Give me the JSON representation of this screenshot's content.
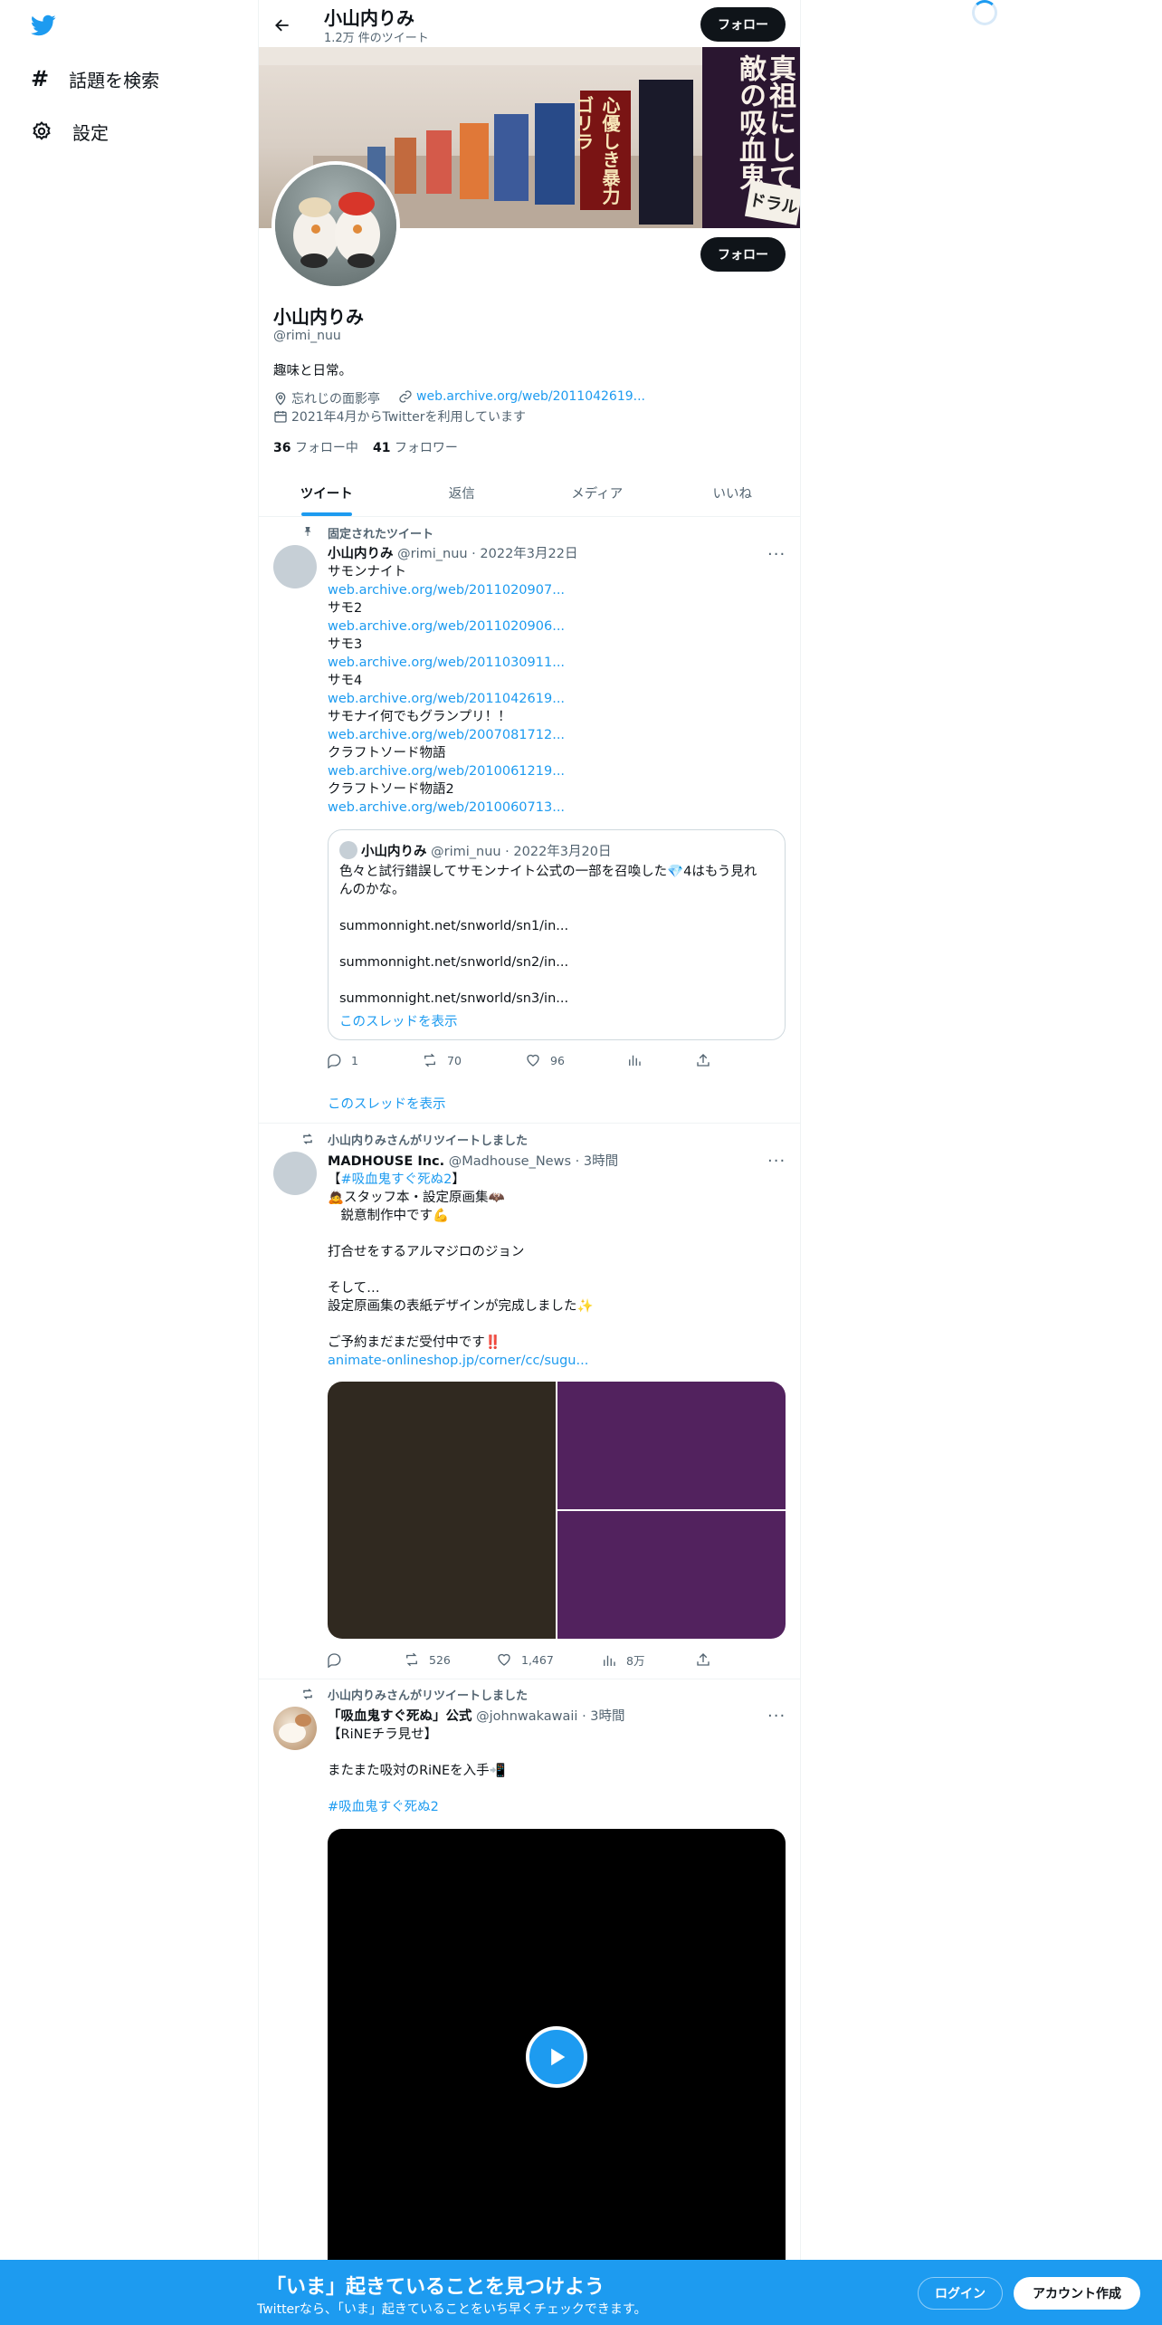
{
  "sidebar": {
    "explore_label": "話題を検索",
    "settings_label": "設定"
  },
  "header": {
    "name": "小山内りみ",
    "tweet_count": "1.2万 件のツイート",
    "follow_label": "フォロー"
  },
  "banner": {
    "texts": [
      "真祖にして",
      "無敵の",
      "吸血鬼",
      "心優しき",
      "暴力ゴリラ",
      "ドラル"
    ]
  },
  "profile": {
    "name": "小山内りみ",
    "handle": "@rimi_nuu",
    "bio": "趣味と日常。",
    "location": "忘れじの面影亭",
    "url": "web.archive.org/web/2011042619...",
    "joined": "2021年4月からTwitterを利用しています",
    "following_count": "36",
    "following_label": "フォロー中",
    "followers_count": "41",
    "followers_label": "フォロワー",
    "follow_label": "フォロー"
  },
  "tabs": [
    "ツイート",
    "返信",
    "メディア",
    "いいね"
  ],
  "tweet1": {
    "pinned_label": "固定されたツイート",
    "name": "小山内りみ",
    "handle": "@rimi_nuu",
    "date": "2022年3月22日",
    "lines": [
      {
        "t": "サモンナイト",
        "l": false
      },
      {
        "t": "web.archive.org/web/2011020907...",
        "l": true
      },
      {
        "t": "サモ2",
        "l": false
      },
      {
        "t": "web.archive.org/web/2011020906...",
        "l": true
      },
      {
        "t": "サモ3",
        "l": false
      },
      {
        "t": "web.archive.org/web/2011030911...",
        "l": true
      },
      {
        "t": "サモ4",
        "l": false
      },
      {
        "t": "web.archive.org/web/2011042619...",
        "l": true
      },
      {
        "t": "サモナイ何でもグランプリ！！",
        "l": false
      },
      {
        "t": "web.archive.org/web/2007081712...",
        "l": true
      },
      {
        "t": "クラフトソード物語",
        "l": false
      },
      {
        "t": "web.archive.org/web/2010061219...",
        "l": true
      },
      {
        "t": "クラフトソード物語2",
        "l": false
      },
      {
        "t": "web.archive.org/web/2010060713...",
        "l": true
      }
    ],
    "quote": {
      "name": "小山内りみ",
      "handle": "@rimi_nuu",
      "date": "2022年3月20日",
      "text1": "色々と試行錯誤してサモンナイト公式の一部を召喚した💎4はもう見れ",
      "text2": "んのかな。",
      "link1": "summonnight.net/snworld/sn1/in...",
      "link2": "summonnight.net/snworld/sn2/in...",
      "link3": "summonnight.net/snworld/sn3/in...",
      "thread_label": "このスレッドを表示"
    },
    "replies": "1",
    "retweets": "70",
    "likes": "96",
    "thread_label": "このスレッドを表示"
  },
  "tweet2": {
    "rt_label": "小山内りみさんがリツイートしました",
    "name": "MADHOUSE Inc.",
    "handle": "@Madhouse_News",
    "time": "3時間",
    "hashtag": "#吸血鬼すぐ死ぬ2",
    "lines": [
      "🙇スタッフ本・設定原画集🦇",
      "　鋭意制作中です💪",
      "",
      "打合せをするアルマジロのジョン",
      "",
      "そして…",
      "設定原画集の表紙デザインが完成しました✨",
      "",
      "ご予約まだまだ受付中です‼️"
    ],
    "link": "animate-onlineshop.jp/corner/cc/sugu...",
    "retweets": "526",
    "likes": "1,467",
    "views": "8万"
  },
  "tweet3": {
    "rt_label": "小山内りみさんがリツイートしました",
    "name": "「吸血鬼すぐ死ぬ」公式",
    "handle": "@johnwakawaii",
    "time": "3時間",
    "line1": "【RiNEチラ見せ】",
    "line2": "またまた吸対のRiNEを入手📲",
    "hashtag": "#吸血鬼すぐ死ぬ2"
  },
  "bottom_bar": {
    "title": "「いま」起きていることを見つけよう",
    "subtitle": "Twitterなら、「いま」起きていることをいち早くチェックできます。",
    "login_label": "ログイン",
    "signup_label": "アカウント作成"
  },
  "colors": {
    "accent": "#1d9bf0",
    "dark": "#0f1419",
    "purple": "#52225e",
    "brown": "#302920"
  }
}
